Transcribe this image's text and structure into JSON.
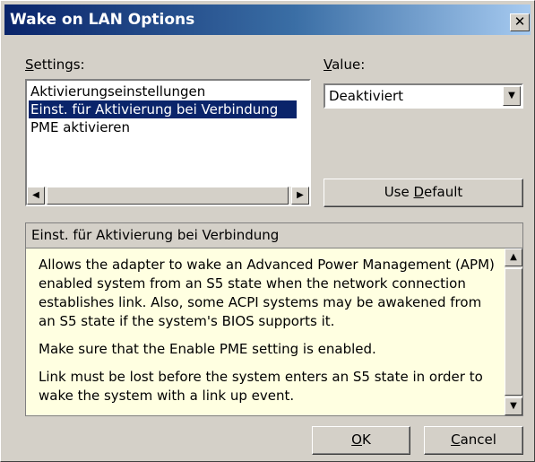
{
  "window": {
    "title": "Wake on LAN Options",
    "close_glyph": "✕"
  },
  "settings": {
    "label_accel": "S",
    "label_rest": "ettings:",
    "items": [
      {
        "label": "Aktivierungseinstellungen",
        "selected": false
      },
      {
        "label": "Einst. für Aktivierung bei Verbindung",
        "selected": true
      },
      {
        "label": "PME aktivieren",
        "selected": false
      }
    ],
    "scroll_left": "◀",
    "scroll_right": "▶"
  },
  "value": {
    "label_accel": "V",
    "label_rest": "alue:",
    "selected": "Deaktiviert",
    "dropdown_glyph": "▼"
  },
  "use_default": {
    "pre": "Use ",
    "accel": "D",
    "post": "efault"
  },
  "description": {
    "header": "Einst. für Aktivierung bei Verbindung",
    "paragraphs": [
      "Allows the adapter to wake an Advanced Power Management (APM) enabled system from an S5 state when the network connection establishes link. Also, some ACPI systems may be awakened from an S5 state if the system's BIOS supports it.",
      "Make sure that the Enable PME setting is enabled.",
      "Link must be lost before the system enters an S5 state in order to wake the system with a link up event."
    ],
    "scroll_up": "▲",
    "scroll_down": "▼"
  },
  "buttons": {
    "ok_accel": "O",
    "ok_rest": "K",
    "cancel_accel": "C",
    "cancel_rest": "ancel"
  }
}
